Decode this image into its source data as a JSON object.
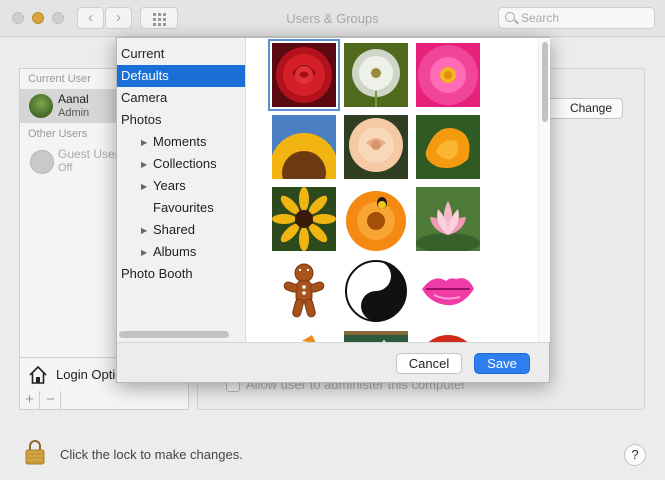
{
  "window": {
    "title": "Users & Groups",
    "search_placeholder": "Search"
  },
  "users": {
    "current_header": "Current User",
    "current_name": "Aanal",
    "current_role": "Admin",
    "other_header": "Other Users",
    "guest_name": "Guest User",
    "guest_status": "Off",
    "login_options": "Login Options",
    "plus": "+",
    "minus": "−"
  },
  "right": {
    "password_button": "Change Password...",
    "admin_label": "Allow user to administer this computer"
  },
  "lock_text": "Click the lock to make changes.",
  "help": "?",
  "picker": {
    "sidebar": [
      {
        "label": "Current",
        "indent": 0,
        "expandable": false,
        "selected": false
      },
      {
        "label": "Defaults",
        "indent": 0,
        "expandable": false,
        "selected": true
      },
      {
        "label": "Camera",
        "indent": 0,
        "expandable": false,
        "selected": false
      },
      {
        "label": "Photos",
        "indent": 0,
        "expandable": false,
        "selected": false
      },
      {
        "label": "Moments",
        "indent": 1,
        "expandable": true,
        "selected": false
      },
      {
        "label": "Collections",
        "indent": 1,
        "expandable": true,
        "selected": false
      },
      {
        "label": "Years",
        "indent": 1,
        "expandable": true,
        "selected": false
      },
      {
        "label": "Favourites",
        "indent": 1,
        "expandable": false,
        "selected": false
      },
      {
        "label": "Shared",
        "indent": 1,
        "expandable": true,
        "selected": false
      },
      {
        "label": "Albums",
        "indent": 1,
        "expandable": true,
        "selected": false
      },
      {
        "label": "Photo Booth",
        "indent": 0,
        "expandable": false,
        "selected": false
      }
    ],
    "images": [
      "red-rose",
      "dandelion",
      "pink-dahlia",
      "sunflower",
      "peach-rose",
      "orange-poppy",
      "black-eyed-susan",
      "orange-gerbera-ladybug",
      "lotus",
      "gingerbread-man",
      "yin-yang",
      "lips",
      "partial-1",
      "chalkboard",
      "gold-medal"
    ],
    "cancel": "Cancel",
    "save": "Save"
  }
}
